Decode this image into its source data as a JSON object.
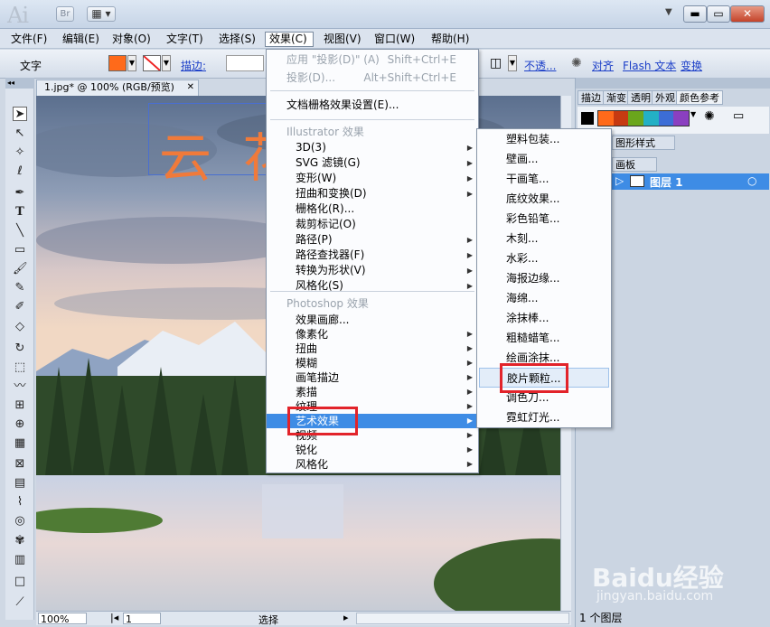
{
  "titlebar": {
    "logo": "Ai",
    "bridge": "Br",
    "arrange": "▦ ▾",
    "min": "▬",
    "max": "▭",
    "close": "✕",
    "drop": "▼"
  },
  "menubar": {
    "items": [
      "文件(F)",
      "编辑(E)",
      "对象(O)",
      "文字(T)",
      "选择(S)",
      "效果(C)",
      "视图(V)",
      "窗口(W)",
      "帮助(H)"
    ]
  },
  "control": {
    "type_label": "文字",
    "stroke_label": "描边:",
    "opacity_label": "不透...",
    "align_label": "对齐",
    "flash_label": "Flash 文本",
    "transform_label": "变换",
    "fill_color": "#ff6a1a"
  },
  "document": {
    "tab_title": "1.jpg* @ 100% (RGB/预览)",
    "canvas_text": "云 花",
    "zoom": "100%",
    "page": "1",
    "status": "选择"
  },
  "right": {
    "tabs": [
      "描边",
      "渐变",
      "透明",
      "外观",
      "颜色参考"
    ],
    "graphic_styles": "图形样式",
    "artboard": "画板",
    "layer_name": "图层 1",
    "layer_count": "1 个图层",
    "swatches": [
      "#ff6a1a",
      "#c63a11",
      "#6aa61c",
      "#23b0c5",
      "#3c6dd6",
      "#8a3fc0"
    ]
  },
  "effect_menu": {
    "apply_last": "应用 \"投影(D)\" (A)",
    "apply_last_sc": "Shift+Ctrl+E",
    "last": "投影(D)...",
    "last_sc": "Alt+Shift+Ctrl+E",
    "raster_settings": "文档栅格效果设置(E)...",
    "ai_header": "Illustrator 效果",
    "ai_items": [
      "3D(3)",
      "SVG 滤镜(G)",
      "变形(W)",
      "扭曲和变换(D)",
      "栅格化(R)...",
      "裁剪标记(O)",
      "路径(P)",
      "路径查找器(F)",
      "转换为形状(V)",
      "风格化(S)"
    ],
    "ps_header": "Photoshop 效果",
    "ps_items": [
      "效果画廊...",
      "像素化",
      "扭曲",
      "模糊",
      "画笔描边",
      "素描",
      "纹理",
      "艺术效果",
      "视频",
      "锐化",
      "风格化"
    ]
  },
  "artistic_submenu": {
    "items": [
      "塑料包装...",
      "壁画...",
      "干画笔...",
      "底纹效果...",
      "彩色铅笔...",
      "木刻...",
      "水彩...",
      "海报边缘...",
      "海绵...",
      "涂抹棒...",
      "粗糙蜡笔...",
      "绘画涂抹...",
      "胶片颗粒...",
      "调色刀...",
      "霓虹灯光..."
    ],
    "hover_index": 12
  },
  "watermark": {
    "brand": "Baidu经验",
    "url": "jingyan.baidu.com"
  }
}
